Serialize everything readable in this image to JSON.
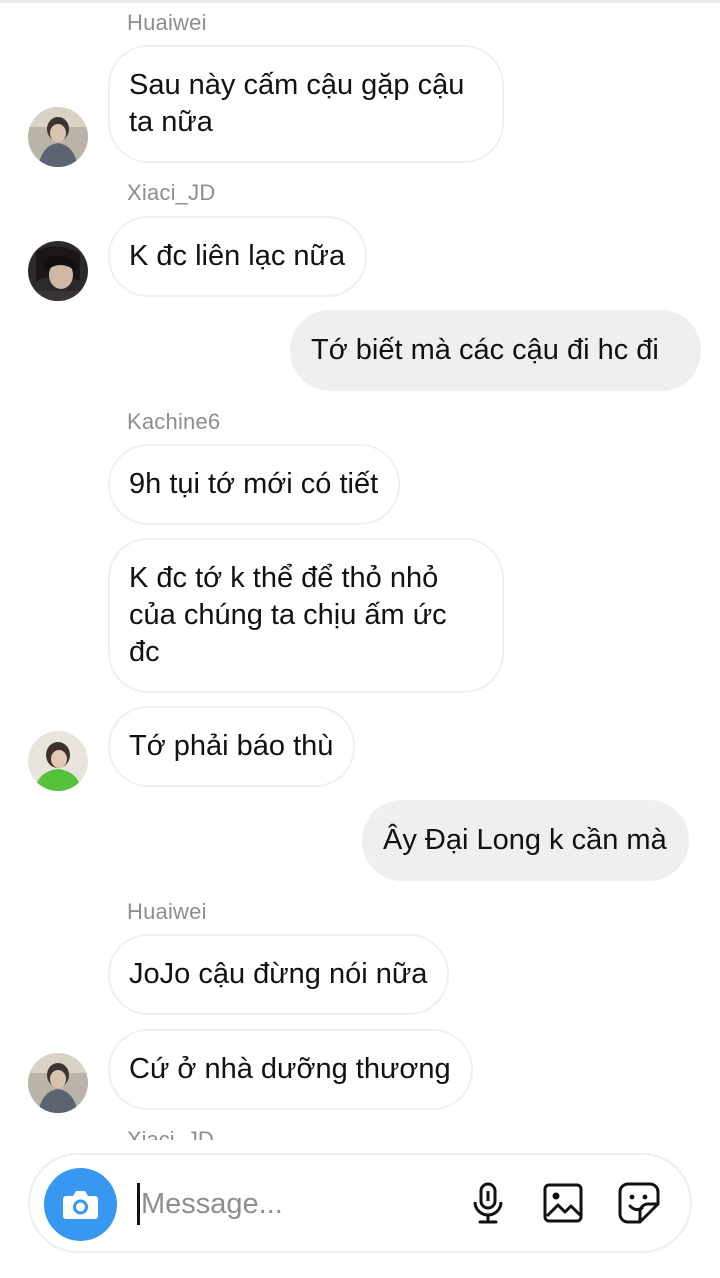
{
  "chat": {
    "messages": [
      {
        "sender": "Huaiwei",
        "text_lines": [
          "Sau này cấm cậu gặp cậu",
          "ta nữa"
        ]
      },
      {
        "sender": "Xiaci_JD",
        "text": "K đc liên lạc nữa"
      },
      {
        "sender": "me",
        "text": "Tớ biết mà các cậu đi hc đi"
      },
      {
        "sender": "Kachine6",
        "text": "9h tụi tớ mới có tiết"
      },
      {
        "sender": "Kachine6",
        "text_lines": [
          "K đc tớ k thể để thỏ nhỏ",
          "của chúng ta chịu ấm ức",
          "đc"
        ]
      },
      {
        "sender": "Kachine6",
        "text": "Tớ phải báo thù"
      },
      {
        "sender": "me",
        "text": "Ây Đại Long k cần mà"
      },
      {
        "sender": "Huaiwei",
        "text": "JoJo cậu đừng nói nữa"
      },
      {
        "sender": "Huaiwei",
        "text": "Cứ ở nhà dưỡng thương"
      }
    ],
    "cut_off_name": "Xiaci_JD"
  },
  "composer": {
    "placeholder": "Message...",
    "icons": [
      "camera-icon",
      "microphone-icon",
      "gallery-icon",
      "sticker-icon"
    ],
    "accent": "#3897f0"
  }
}
